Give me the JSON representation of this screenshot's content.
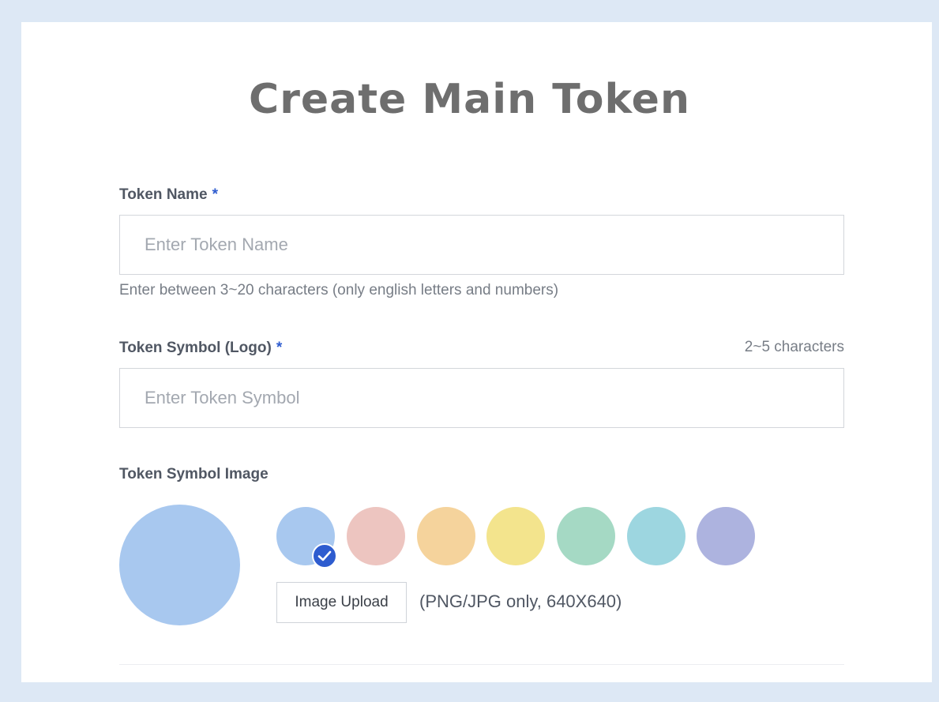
{
  "page": {
    "title": "Create Main Token"
  },
  "token_name": {
    "label": "Token Name",
    "required_mark": "*",
    "placeholder": "Enter Token Name",
    "value": "",
    "helper": "Enter between 3~20 characters (only english letters and numbers)"
  },
  "token_symbol": {
    "label": "Token Symbol (Logo)",
    "required_mark": "*",
    "char_hint": "2~5 characters",
    "placeholder": "Enter Token Symbol",
    "value": ""
  },
  "symbol_image": {
    "label": "Token Symbol Image",
    "selected_color": "#a8c8ef",
    "swatches": [
      {
        "color": "#a8c8ef",
        "selected": true
      },
      {
        "color": "#edc5c0",
        "selected": false
      },
      {
        "color": "#f5d39c",
        "selected": false
      },
      {
        "color": "#f3e48d",
        "selected": false
      },
      {
        "color": "#a5d9c4",
        "selected": false
      },
      {
        "color": "#9dd6e0",
        "selected": false
      },
      {
        "color": "#adb3df",
        "selected": false
      }
    ],
    "upload_label": "Image Upload",
    "upload_note": "(PNG/JPG only, 640X640)",
    "check_icon": "check-icon"
  },
  "colors": {
    "accent": "#2e5ccf",
    "background": "#dde8f5"
  }
}
